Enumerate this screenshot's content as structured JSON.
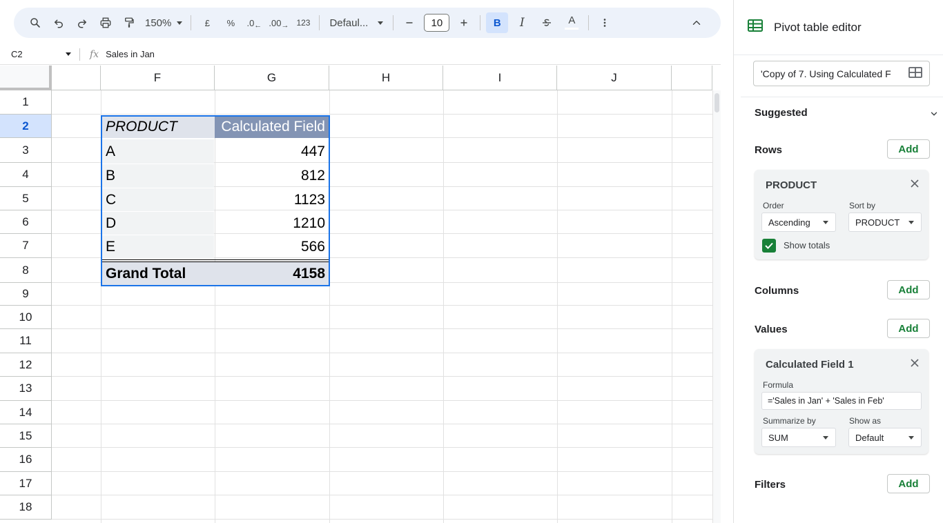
{
  "toolbar": {
    "zoom": "150%",
    "currency": "£",
    "percent": "%",
    "dec_decrease": ".0",
    "dec_increase": ".00",
    "number_format": "123",
    "font": "Defaul...",
    "font_size": "10",
    "bold": "B",
    "italic": "I",
    "text_color": "A"
  },
  "formula_bar": {
    "cell_ref": "C2",
    "fx": "fx",
    "content": "Sales in Jan"
  },
  "grid": {
    "columns": [
      "F",
      "G",
      "H",
      "I",
      "J"
    ],
    "rows": [
      "1",
      "2",
      "3",
      "4",
      "5",
      "6",
      "7",
      "8",
      "9",
      "10",
      "11",
      "12",
      "13",
      "14",
      "15",
      "16",
      "17",
      "18"
    ],
    "active_row": "2"
  },
  "pivot": {
    "header_product": "PRODUCT",
    "header_value": "Calculated Field",
    "rows": [
      {
        "product": "A",
        "value": "447"
      },
      {
        "product": "B",
        "value": "812"
      },
      {
        "product": "C",
        "value": "1123"
      },
      {
        "product": "D",
        "value": "1210"
      },
      {
        "product": "E",
        "value": "566"
      }
    ],
    "total_label": "Grand Total",
    "total_value": "4158"
  },
  "panel": {
    "title": "Pivot table editor",
    "range": "'Copy of 7. Using Calculated F",
    "suggested": "Suggested",
    "rows_label": "Rows",
    "columns_label": "Columns",
    "values_label": "Values",
    "filters_label": "Filters",
    "add": "Add",
    "row_card": {
      "title": "PRODUCT",
      "order_label": "Order",
      "order_value": "Ascending",
      "sort_label": "Sort by",
      "sort_value": "PRODUCT",
      "show_totals": "Show totals"
    },
    "value_card": {
      "title": "Calculated Field 1",
      "formula_label": "Formula",
      "formula_value": "='Sales in Jan' + 'Sales in Feb'",
      "summarize_label": "Summarize by",
      "summarize_value": "SUM",
      "show_as_label": "Show as",
      "show_as_value": "Default"
    }
  },
  "colors": {
    "accent_blue": "#1a73e8",
    "header_fill": "#8394b4",
    "add_green": "#188038",
    "toolbar_bg": "#edf2fa"
  }
}
